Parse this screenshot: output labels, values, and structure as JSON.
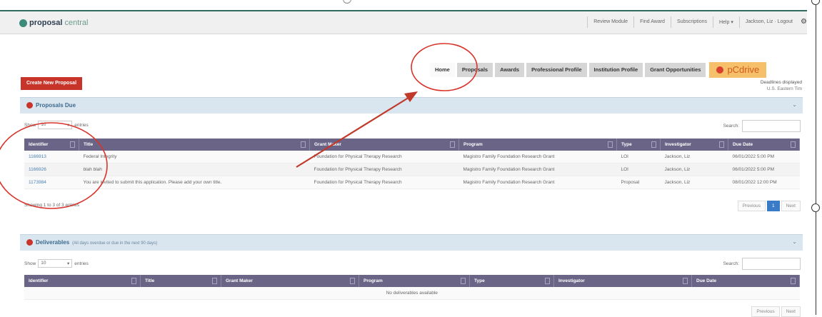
{
  "app": {
    "logo_bold": "proposal",
    "logo_rest": "central"
  },
  "toplinks": [
    "Review Module",
    "Find Award",
    "Subscriptions",
    "Help ▾",
    "Jackson, Liz · Logout"
  ],
  "tabs": [
    {
      "label": "Home",
      "active": true
    },
    {
      "label": "Proposals",
      "active": false
    },
    {
      "label": "Awards",
      "active": false
    },
    {
      "label": "Professional Profile",
      "active": false
    },
    {
      "label": "Institution Profile",
      "active": false
    },
    {
      "label": "Grant Opportunities",
      "active": false
    }
  ],
  "pcdrive_label": "pCdrive",
  "create_button": "Create New Proposal",
  "deadline_note": {
    "line1": "Deadlines displayed",
    "line2": "U.S. Eastern Tim"
  },
  "proposals_due": {
    "title": "Proposals Due",
    "show_label": "Show",
    "show_value": "10",
    "entries_label": "entries",
    "search_label": "Search:",
    "columns": [
      "Identifier",
      "Title",
      "Grant Maker",
      "Program",
      "Type",
      "Investigator",
      "Due Date"
    ],
    "rows": [
      [
        "1166913",
        "Federal Integrity",
        "Foundation for Physical Therapy Research",
        "Magistro Family Foundation Research Grant",
        "LOI",
        "Jackson, Liz",
        "06/01/2022 5:00 PM"
      ],
      [
        "1166926",
        "blah blah",
        "Foundation for Physical Therapy Research",
        "Magistro Family Foundation Research Grant",
        "LOI",
        "Jackson, Liz",
        "06/01/2022 5:00 PM"
      ],
      [
        "1173984",
        "You are invited to submit this application. Please add your own title.",
        "Foundation for Physical Therapy Research",
        "Magistro Family Foundation Research Grant",
        "Proposal",
        "Jackson, Liz",
        "08/01/2022 12:00 PM"
      ]
    ],
    "showing": "Showing 1 to 3 of 3 entries",
    "pager": {
      "previous": "Previous",
      "page": "1",
      "next": "Next"
    }
  },
  "deliverables": {
    "title": "Deliverables",
    "subtitle": "(All days overdue or due in the next 90 days)",
    "show_label": "Show",
    "show_value": "10",
    "entries_label": "entries",
    "search_label": "Search:",
    "columns": [
      "Identifier",
      "Title",
      "Grant Maker",
      "Program",
      "Type",
      "Investigator",
      "Due Date"
    ],
    "empty": "No deliverables available",
    "pager": {
      "previous": "Previous",
      "next": "Next"
    }
  },
  "colors": {
    "header_purple": "#6a6486",
    "create_red": "#c9342a",
    "annot_red": "#d9342b"
  }
}
